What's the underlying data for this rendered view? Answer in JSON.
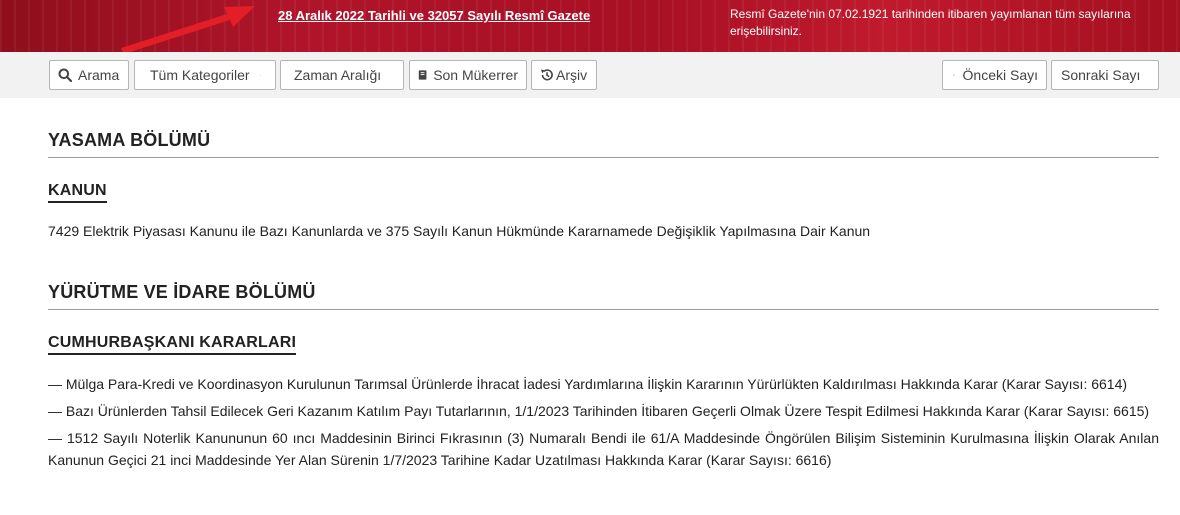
{
  "header": {
    "title": "28 Aralık 2022 Tarihli ve 32057 Sayılı Resmî Gazete",
    "note": "Resmî Gazete'nin 07.02.1921 tarihinden itibaren yayımlanan tüm sayılarına erişebilirsiniz."
  },
  "toolbar": {
    "search_label": "Arama",
    "category_select": "Tüm Kategoriler",
    "time_select": "Zaman Aralığı",
    "repeat_label": "Son Mükerrer",
    "archive_label": "Arşiv",
    "prev_label": "Önceki Sayı",
    "next_label": "Sonraki Sayı"
  },
  "sections": [
    {
      "title": "YASAMA BÖLÜMÜ",
      "subsections": [
        {
          "title": "KANUN",
          "items": [
            "7429 Elektrik Piyasası Kanunu ile Bazı Kanunlarda ve 375 Sayılı Kanun Hükmünde Kararnamede Değişiklik Yapılmasına Dair Kanun"
          ]
        }
      ]
    },
    {
      "title": "YÜRÜTME VE İDARE BÖLÜMÜ",
      "subsections": [
        {
          "title": "CUMHURBAŞKANI KARARLARI",
          "items": [
            "— Mülga Para-Kredi ve Koordinasyon Kurulunun Tarımsal Ürünlerde İhracat İadesi Yardımlarına İlişkin Kararının Yürürlükten Kaldırılması Hakkında Karar (Karar Sayısı: 6614)",
            "— Bazı Ürünlerden Tahsil Edilecek Geri Kazanım Katılım Payı Tutarlarının, 1/1/2023 Tarihinden İtibaren Geçerli Olmak Üzere Tespit Edilmesi Hakkında Karar (Karar Sayısı: 6615)",
            "— 1512 Sayılı Noterlik Kanununun 60 ıncı Maddesinin Birinci Fıkrasının (3) Numaralı Bendi ile 61/A Maddesinde Öngörülen Bilişim Sisteminin Kurulmasına İlişkin Olarak Anılan Kanunun Geçici 21 inci Maddesinde Yer Alan Sürenin 1/7/2023 Tarihine Kadar Uzatılması Hakkında Karar (Karar Sayısı: 6616)"
          ]
        }
      ]
    }
  ],
  "colors": {
    "banner": "#b0142a",
    "arrow": "#e41e26"
  }
}
